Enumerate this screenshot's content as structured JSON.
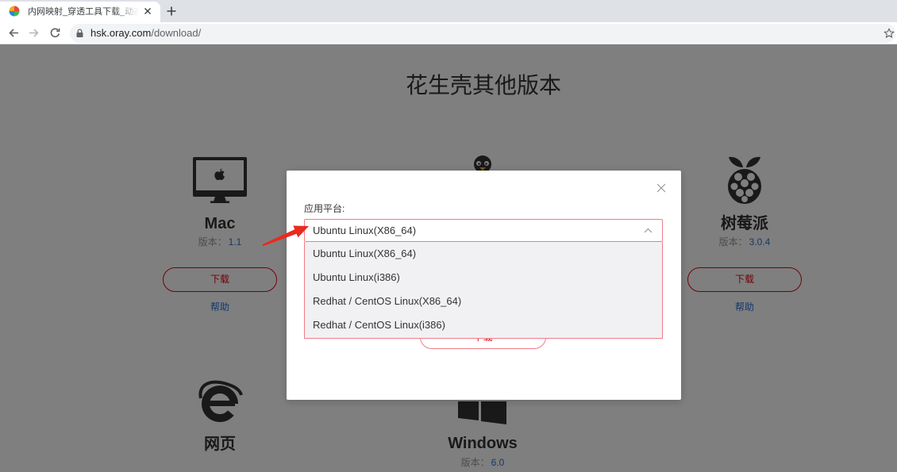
{
  "browser": {
    "tab_title": "内网映射_穿透工具下载_动态域名",
    "url_host": "hsk.oray.com",
    "url_path": "/download/",
    "icons": {
      "favicon": "oray-favicon-icon",
      "tab_close": "close-icon",
      "new_tab": "plus-icon",
      "back": "arrow-left-icon",
      "forward": "arrow-right-icon",
      "reload": "reload-icon",
      "secure": "lock-icon",
      "bookmark": "star-icon"
    }
  },
  "page": {
    "title": "花生壳其他版本",
    "products": {
      "mac": {
        "name": "Mac",
        "version_label": "版本：",
        "version": "1.1",
        "download": "下载",
        "help": "帮助",
        "icon": "apple-monitor-icon"
      },
      "linux": {
        "icon": "linux-penguin-icon"
      },
      "raspberry": {
        "name": "树莓派",
        "version_label": "版本：",
        "version": "3.0.4",
        "download": "下载",
        "help": "帮助",
        "icon": "raspberry-pi-icon"
      },
      "web": {
        "name": "网页",
        "icon": "ie-browser-icon"
      },
      "windows": {
        "name": "Windows",
        "version_label": "版本：",
        "version": "6.0",
        "icon": "windows-icon"
      }
    }
  },
  "modal": {
    "platform_label": "应用平台:",
    "selected": "Ubuntu Linux(X86_64)",
    "options": [
      "Ubuntu Linux(X86_64)",
      "Ubuntu Linux(i386)",
      "Redhat / CentOS Linux(X86_64)",
      "Redhat / CentOS Linux(i386)"
    ],
    "download": "下载",
    "icons": {
      "close": "close-icon",
      "select_toggle": "chevron-up-icon"
    }
  },
  "annotation": {
    "icon": "red-arrow-icon"
  },
  "colors": {
    "accent_red": "#e60012",
    "link_blue": "#2b6fd6",
    "select_border": "#f07c88",
    "dropdown_bg": "#f1f1f3",
    "overlay": "rgba(0,0,0,0.5)",
    "annotation_red": "#ea2a1f"
  }
}
